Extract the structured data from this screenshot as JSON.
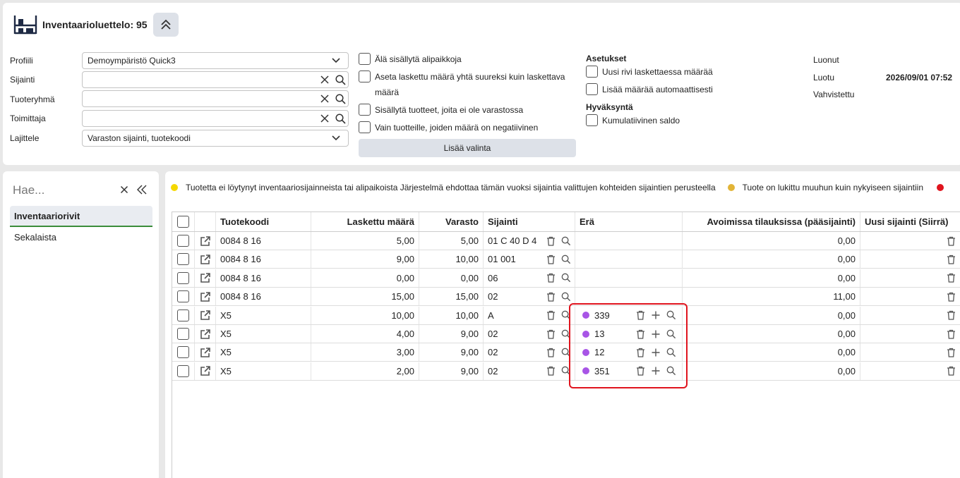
{
  "header": {
    "title": "Inventaarioluettelo: 95"
  },
  "filters": [
    {
      "label": "Profiili",
      "value": "Demoympäristö Quick3",
      "kind": "select"
    },
    {
      "label": "Sijainti",
      "value": "",
      "kind": "search"
    },
    {
      "label": "Tuoteryhmä",
      "value": "",
      "kind": "search"
    },
    {
      "label": "Toimittaja",
      "value": "",
      "kind": "search"
    },
    {
      "label": "Lajittele",
      "value": "Varaston sijainti, tuotekoodi",
      "kind": "select"
    }
  ],
  "options": {
    "exclude_subplaces": "Älä sisällytä alipaikkoja",
    "set_counted_line1": "Aseta laskettu määrä yhtä suureksi kuin laskettava",
    "set_counted_line2": "määrä",
    "include_no_stock": "Sisällytä tuotteet, joita ei ole varastossa",
    "only_negative": "Vain tuotteille, joiden määrä on negatiivinen",
    "add_selection": "Lisää valinta"
  },
  "settings": {
    "title": "Asetukset",
    "new_row": "Uusi rivi laskettaessa määrää",
    "add_auto": "Lisää määrää automaattisesti",
    "approval_title": "Hyväksyntä",
    "cumulative": "Kumulatiivinen saldo"
  },
  "meta": {
    "created_label": "Luonut",
    "created_value": "",
    "made_label": "Luotu",
    "made_value": "2026/09/01 07:52",
    "confirmed_label": "Vahvistettu",
    "confirmed_value": ""
  },
  "sidebar": {
    "search_placeholder": "Hae...",
    "items": [
      {
        "label": "Inventaariorivit",
        "active": true
      },
      {
        "label": "Sekalaista",
        "active": false
      }
    ]
  },
  "legend": {
    "item1": "Tuotetta ei löytynyt inventaariosijainneista tai alipaikoista Järjestelmä ehdottaa tämän vuoksi sijaintia valittujen kohteiden sijaintien perusteella",
    "item1_color": "#f5d800",
    "item2": "Tuote on lukittu muuhun kuin nykyiseen sijaintiin",
    "item2_color": "#e2b437",
    "item3_color": "#e0141e"
  },
  "table": {
    "columns": {
      "code": "Tuotekoodi",
      "counted": "Laskettu määrä",
      "stock": "Varasto",
      "location": "Sijainti",
      "batch": "Erä",
      "open_orders": "Avoimissa tilauksissa (pääsijainti)",
      "new_location": "Uusi sijainti (Siirrä)"
    },
    "rows": [
      {
        "code": "0084 8 16",
        "counted": "5,00",
        "stock": "5,00",
        "location": "01 C 40 D 4",
        "batch": "",
        "open": "0,00"
      },
      {
        "code": "0084 8 16",
        "counted": "9,00",
        "stock": "10,00",
        "location": "01 001",
        "batch": "",
        "open": "0,00"
      },
      {
        "code": "0084 8 16",
        "counted": "0,00",
        "stock": "0,00",
        "location": "06",
        "batch": "",
        "open": "0,00"
      },
      {
        "code": "0084 8 16",
        "counted": "15,00",
        "stock": "15,00",
        "location": "02",
        "batch": "",
        "open": "11,00"
      },
      {
        "code": "X5",
        "counted": "10,00",
        "stock": "10,00",
        "location": "A",
        "batch": "339",
        "open": "0,00"
      },
      {
        "code": "X5",
        "counted": "4,00",
        "stock": "9,00",
        "location": "02",
        "batch": "13",
        "open": "0,00"
      },
      {
        "code": "X5",
        "counted": "3,00",
        "stock": "9,00",
        "location": "02",
        "batch": "12",
        "open": "0,00"
      },
      {
        "code": "X5",
        "counted": "2,00",
        "stock": "9,00",
        "location": "02",
        "batch": "351",
        "open": "0,00"
      }
    ]
  }
}
